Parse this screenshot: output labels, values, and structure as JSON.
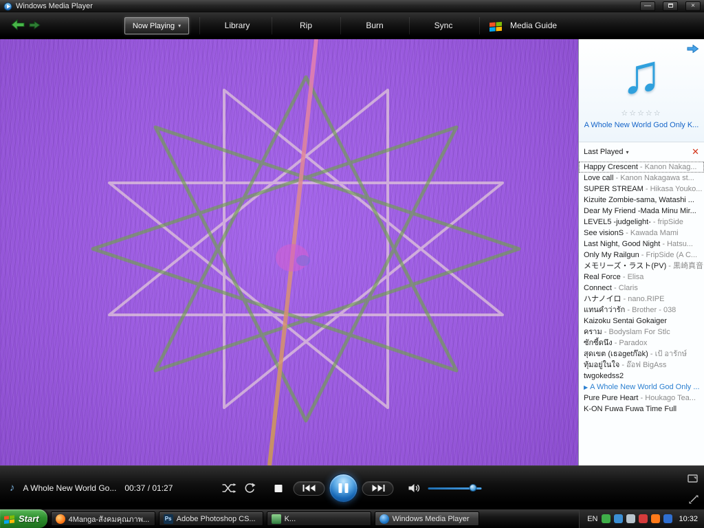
{
  "window": {
    "title": "Windows Media Player"
  },
  "icons": {
    "minimize_glyph": "—",
    "close_glyph": "×",
    "now_playing_caret": "▾",
    "playlist_caret": "▾",
    "clear_list_glyph": "✕",
    "playing_indicator": "▶",
    "album_note_glyph": "♫",
    "transport_note_glyph": "♪"
  },
  "nav": {
    "tabs": [
      {
        "label": "Now Playing"
      },
      {
        "label": "Library"
      },
      {
        "label": "Rip"
      },
      {
        "label": "Burn"
      },
      {
        "label": "Sync"
      },
      {
        "label": "Media Guide"
      }
    ]
  },
  "sidebar": {
    "now_playing_link": "A Whole New World God Only K...",
    "stars_display": "☆☆☆☆☆",
    "playlist_header": {
      "label": "Last Played"
    },
    "playlist": [
      {
        "title": "Happy Crescent",
        "artist": "Kanon Nakag...",
        "state": "selected"
      },
      {
        "title": "Love call",
        "artist": "Kanon Nakagawa st...",
        "state": ""
      },
      {
        "title": "SUPER STREAM",
        "artist": "Hikasa Youko...",
        "state": ""
      },
      {
        "title": "Kizuite Zombie-sama, Watashi ...",
        "artist": "",
        "state": ""
      },
      {
        "title": "Dear My Friend -Mada Minu Mir...",
        "artist": "",
        "state": ""
      },
      {
        "title": "LEVEL5 -judgelight-",
        "artist": "fripSide",
        "state": ""
      },
      {
        "title": "See visionS",
        "artist": "Kawada Mami",
        "state": ""
      },
      {
        "title": "Last Night, Good Night",
        "artist": "Hatsu...",
        "state": ""
      },
      {
        "title": "Only My Railgun",
        "artist": "FripSide (A C...",
        "state": ""
      },
      {
        "title": "メモリーズ・ラスト(PV)",
        "artist": "黒崎真音",
        "state": ""
      },
      {
        "title": "Real Force",
        "artist": "Elisa",
        "state": ""
      },
      {
        "title": "Connect",
        "artist": "Claris",
        "state": ""
      },
      {
        "title": "ハナノイロ",
        "artist": "nano.RIPE",
        "state": ""
      },
      {
        "title": "แทนคำว่ารัก",
        "artist": "Brother - 038",
        "state": ""
      },
      {
        "title": "Kaizoku Sentai Gokaiger",
        "artist": "",
        "state": ""
      },
      {
        "title": "คราม",
        "artist": "Bodyslam For Stlc",
        "state": ""
      },
      {
        "title": "ซักซี้ดนึง",
        "artist": "Paradox",
        "state": ""
      },
      {
        "title": "สุดเขต (เธอgetก๊อk)",
        "artist": "เป้ อารักษ์",
        "state": ""
      },
      {
        "title": "ทุ้มอยู่ในใจ",
        "artist": "อ๊อฟ BigAss",
        "state": ""
      },
      {
        "title": "twgokedss2",
        "artist": "",
        "state": ""
      },
      {
        "title": "A Whole New World God Only ...",
        "artist": "",
        "state": "playing"
      },
      {
        "title": "Pure Pure Heart",
        "artist": "Houkago Tea...",
        "state": ""
      },
      {
        "title": "K-ON Fuwa Fuwa Time Full",
        "artist": "",
        "state": ""
      }
    ]
  },
  "transport": {
    "track_label": "A Whole New World Go...",
    "time_display": "00:37 / 01:27",
    "volume_percent": 83
  },
  "taskbar": {
    "start_label": "Start",
    "tasks": [
      {
        "label": "4Manga-สังคมคุณภาพ...",
        "icon": "firefox",
        "icon_text": "",
        "active": false
      },
      {
        "label": "Adobe Photoshop CS...",
        "icon": "photoshop",
        "icon_text": "Ps",
        "active": false
      },
      {
        "label": "K...",
        "icon": "window",
        "icon_text": "",
        "active": false
      },
      {
        "label": "Windows Media Player",
        "icon": "wmp",
        "icon_text": "",
        "active": true
      }
    ],
    "tray": {
      "language": "EN",
      "clock": "10:32",
      "icons": [
        {
          "name": "antivirus-tray-icon",
          "color": "#3fae49"
        },
        {
          "name": "network-tray-icon",
          "color": "#3b8fd4"
        },
        {
          "name": "volume-tray-icon",
          "color": "#b8c4cc"
        },
        {
          "name": "messenger-tray-icon",
          "color": "#d43b3b"
        },
        {
          "name": "firefox-tray-icon",
          "color": "#ff7a1a"
        },
        {
          "name": "update-shield-tray-icon",
          "color": "#2f6fd0"
        }
      ]
    }
  },
  "colors": {
    "viz_purple": "#9a5ade",
    "star_green": "#6fa24b",
    "star_pink": "#dcc0da",
    "playing_blue": "#2a7fd0",
    "link_blue": "#1464c8",
    "accent_blue": "#2f8fd6",
    "start_green": "#2e8f2e"
  }
}
